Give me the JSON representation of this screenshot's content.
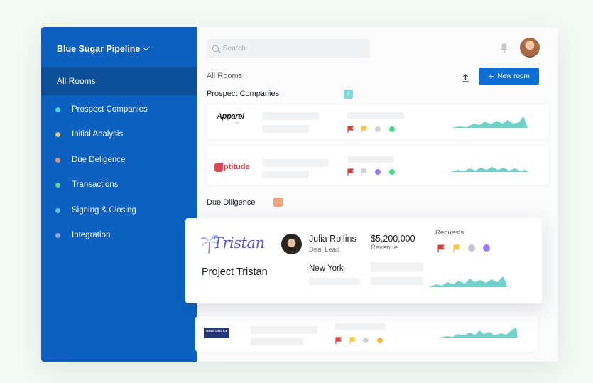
{
  "sidebar": {
    "pipeline_title": "Blue Sugar Pipeline",
    "active_item": "All Rooms",
    "items": [
      {
        "label": "Prospect Companies",
        "color": "#45d4e0"
      },
      {
        "label": "Initial Analysis",
        "color": "#e8c46a"
      },
      {
        "label": "Due Deligence",
        "color": "#e4906c"
      },
      {
        "label": "Transactions",
        "color": "#5ad88a"
      },
      {
        "label": "Signing & Closing",
        "color": "#5fc2ec"
      },
      {
        "label": "Integration",
        "color": "#8e9fec"
      }
    ]
  },
  "header": {
    "search_placeholder": "Search",
    "bell_icon": "bell-icon",
    "upload_icon": "upload-icon"
  },
  "toolbar": {
    "breadcrumb": "All Rooms",
    "new_room_label": "New room"
  },
  "sections": {
    "prospect": {
      "title": "Prospect Companies",
      "count": "2",
      "badge_color": "#7fd9d6"
    },
    "due": {
      "title": "Due Diligence",
      "count": "1",
      "badge_color": "#f0a27b"
    }
  },
  "companies": [
    {
      "logo_text": "Apparel",
      "logo_sub": "CO.",
      "flags": [
        "#e53935",
        "#f5c842"
      ],
      "dots": [
        "#cfd3d8",
        "#4fd88b"
      ]
    },
    {
      "logo_text": "ptitude",
      "flags": [
        "#e53935",
        "#cfd3d8"
      ],
      "dots": [
        "#9a7cf1",
        "#4fd88b"
      ]
    },
    {
      "logo_text": "Good District",
      "flags": [
        "#e53935",
        "#f5c842"
      ],
      "dots": [
        "#cfd3d8",
        "#f5b942"
      ]
    }
  ],
  "featured": {
    "logo_text": "Tristan",
    "project": "Project Tristan",
    "lead_name": "Julia Rollins",
    "lead_role": "Deal Lead",
    "revenue": "$5,200,000",
    "revenue_label": "Revenue",
    "location": "New York",
    "requests_label": "Requests",
    "flags": [
      "#e53935",
      "#f5c842"
    ],
    "dots": [
      "#c4c8ce",
      "#9a7cf1"
    ]
  },
  "colors": {
    "sidebar": "#0c61c0",
    "sidebar_active": "#0d4f99",
    "primary": "#0d6fd6",
    "spark": "#6fd3cc"
  }
}
